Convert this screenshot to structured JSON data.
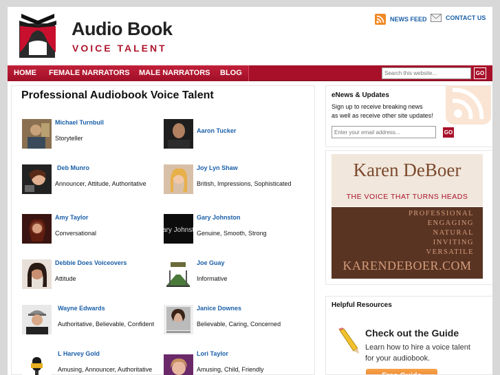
{
  "site": {
    "logo_title": "Audio Book",
    "logo_subtitle": "VOICE TALENT"
  },
  "top_links": {
    "news_feed": "NEWS FEED",
    "contact_us": "CONTACT US"
  },
  "nav": {
    "items": [
      "HOME",
      "FEMALE NARRATORS",
      "MALE NARRATORS",
      "BLOG"
    ],
    "search_placeholder": "Search this website...",
    "search_go": "GO"
  },
  "main": {
    "title": "Professional Audiobook Voice Talent",
    "narrators": [
      {
        "name": "Michael Turnbull",
        "style": "Storyteller"
      },
      {
        "name": "Aaron Tucker",
        "style": ""
      },
      {
        "name": "Deb Munro",
        "style": "Announcer, Attitude, Authoritative"
      },
      {
        "name": "Joy Lyn Shaw",
        "style": "British, Impressions, Sophisticated"
      },
      {
        "name": "Amy Taylor",
        "style": "Conversational"
      },
      {
        "name": "Gary Johnston",
        "style": "Genuine, Smooth, Strong"
      },
      {
        "name": "Debbie Does Voiceovers",
        "style": "Attitude"
      },
      {
        "name": "Joe Guay",
        "style": "Informative"
      },
      {
        "name": "Wayne Edwards",
        "style": "Authoritative, Believable, Confident"
      },
      {
        "name": "Janice Downes",
        "style": "Believable, Caring, Concerned"
      },
      {
        "name": "L Harvey Gold",
        "style": "Amusing, Announcer, Authoritative"
      },
      {
        "name": "Lori Taylor",
        "style": "Amusing, Child, Friendly"
      }
    ]
  },
  "sidebar": {
    "enews": {
      "title": "eNews & Updates",
      "text_line1": "Sign up to receive breaking news",
      "text_line2": "as well as receive other site updates!",
      "email_placeholder": "Enter your email address...",
      "go": "GO"
    },
    "ad": {
      "name": "Karen DeBoer",
      "tagline": "THE VOICE THAT TURNS HEADS",
      "words": [
        "PROFESSIONAL",
        "ENGAGING",
        "NATURAL",
        "INVITING",
        "VERSATILE"
      ],
      "url": "KARENDEBOER.COM"
    },
    "resources": {
      "title": "Helpful Resources",
      "guide_title": "Check out the Guide",
      "guide_text1": "Learn how to hire a voice talent",
      "guide_text2": "for your audiobook.",
      "guide_button": "Free Guide"
    }
  },
  "colors": {
    "nav_red": "#a8102a",
    "link_blue": "#1a5fa8"
  }
}
